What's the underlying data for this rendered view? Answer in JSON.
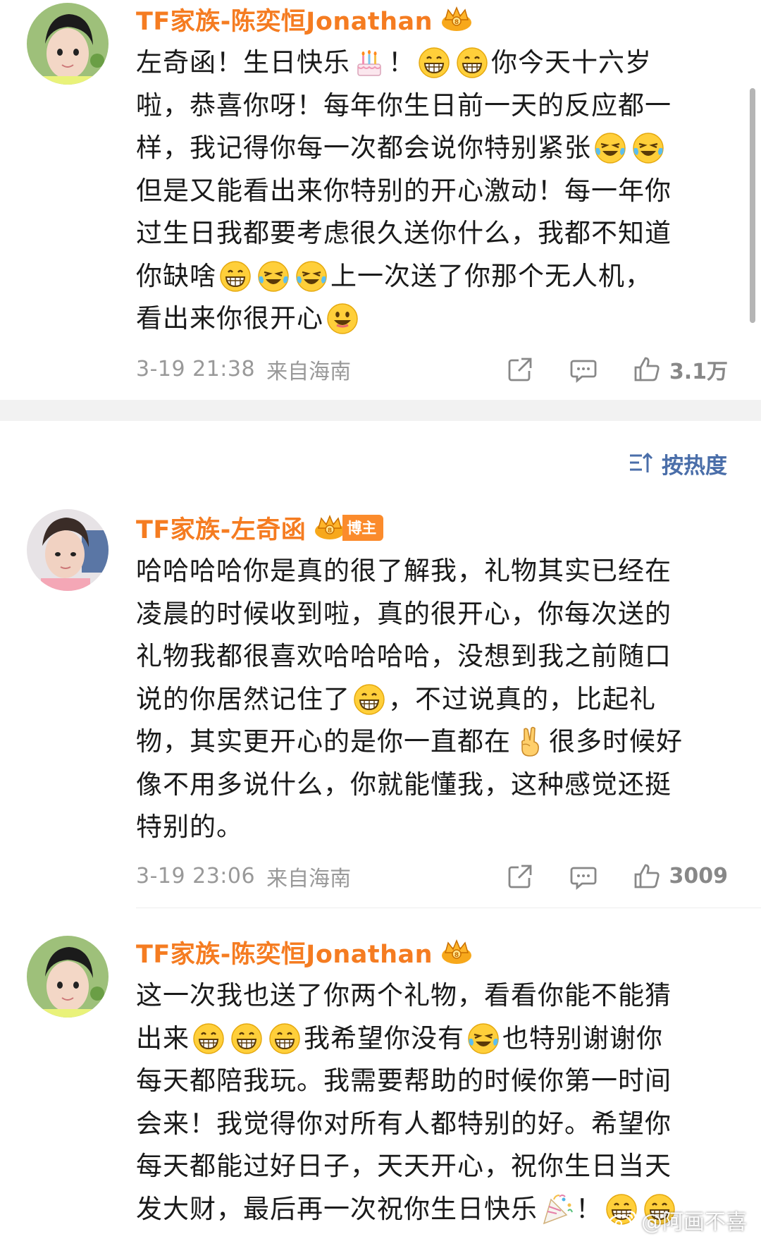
{
  "sort": {
    "label": "按热度",
    "icon": "sort-icon"
  },
  "watermark": {
    "text": "@阿画不喜",
    "icon": "weibo-logo-icon"
  },
  "comments": [
    {
      "user": {
        "name": "TF家族-陈奕恒Jonathan",
        "badge_icon": "crown-vip-icon"
      },
      "lines": [
        [
          "左奇函！生日快乐",
          "[cake]",
          "！",
          "[grin]",
          "[grin]",
          "你今天十六岁"
        ],
        [
          "啦，恭喜你呀！每年你生日前一天的反应都一"
        ],
        [
          "样，我记得你每一次都会说你特别紧张",
          "[laughcry]",
          "[laughcry]"
        ],
        [
          "但是又能看出来你特别的开心激动！每一年你"
        ],
        [
          "过生日我都要考虑很久送你什么，我都不知道"
        ],
        [
          "你缺啥",
          "[grin]",
          "[laughcry]",
          "[laughcry]",
          "上一次送了你那个无人机，"
        ],
        [
          "看出来你很开心",
          "[smile]"
        ]
      ],
      "time": "3-19 21:38",
      "location": "来自海南",
      "likes": "3.1万"
    },
    {
      "user": {
        "name": "TF家族-左奇函",
        "badge_icon": "crown-vip-icon",
        "tag": "博主"
      },
      "lines": [
        [
          "哈哈哈哈你是真的很了解我，礼物其实已经在"
        ],
        [
          "凌晨的时候收到啦，真的很开心，你每次送的"
        ],
        [
          "礼物我都很喜欢哈哈哈哈，没想到我之前随口"
        ],
        [
          "说的你居然记住了",
          "[grin]",
          "，不过说真的，比起礼"
        ],
        [
          "物，其实更开心的是你一直都在",
          "[victory]",
          "很多时候好"
        ],
        [
          "像不用多说什么，你就能懂我，这种感觉还挺"
        ],
        [
          "特别的。"
        ]
      ],
      "time": "3-19 23:06",
      "location": "来自海南",
      "likes": "3009"
    },
    {
      "user": {
        "name": "TF家族-陈奕恒Jonathan",
        "badge_icon": "crown-vip-icon"
      },
      "lines": [
        [
          "这一次我也送了你两个礼物，看看你能不能猜"
        ],
        [
          "出来",
          "[grin]",
          "[grin]",
          "[grin]",
          "我希望你没有",
          "[laughcry]",
          "也特别谢谢你"
        ],
        [
          "每天都陪我玩。我需要帮助的时候你第一时间"
        ],
        [
          "会来！我觉得你对所有人都特别的好。希望你"
        ],
        [
          "每天都能过好日子，天天开心，祝你生日当天"
        ],
        [
          "发大财，最后再一次祝你生日快乐",
          "[party]",
          "！",
          "[grin]",
          "[grin]"
        ]
      ]
    }
  ]
}
